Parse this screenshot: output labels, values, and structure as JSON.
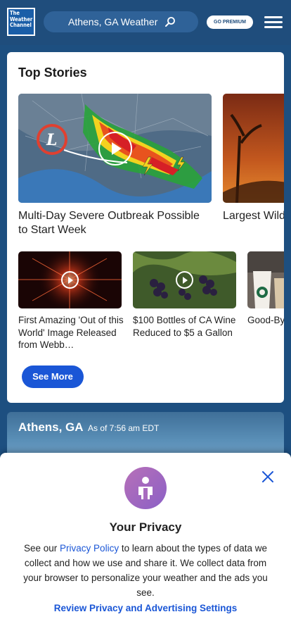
{
  "header": {
    "logo_lines": [
      "The",
      "Weather",
      "Channel"
    ],
    "search_text": "Athens, GA Weather",
    "premium_label": "GO PREMIUM"
  },
  "top_stories": {
    "title": "Top Stories",
    "big_cards": [
      {
        "title": "Multi-Day Severe Outbreak Possible to Start Week",
        "video": true
      },
      {
        "title": "Largest Wildfire Continues to",
        "video": false
      }
    ],
    "small_cards": [
      {
        "title": "First Amazing 'Out of this World' Image Released from Webb…",
        "video": true
      },
      {
        "title": "$100 Bottles of CA Wine Reduced to $5 a Gallon",
        "video": true
      },
      {
        "title": "Good-Bye Cups at S",
        "video": false
      }
    ],
    "see_more_label": "See More"
  },
  "location": {
    "city": "Athens, GA",
    "as_of": "As of 7:56 am EDT"
  },
  "privacy": {
    "title": "Your Privacy",
    "body_prefix": "See our ",
    "policy_link": "Privacy Policy",
    "body_suffix": " to learn about the types of data we collect and how we use and share it. We collect data from your browser to personalize your weather and the ads you see.",
    "review_link": "Review Privacy and Advertising Settings"
  },
  "colors": {
    "header_bg": "#1f4d7c",
    "accent_blue": "#1a56d6",
    "privacy_icon": "#a06abf"
  }
}
